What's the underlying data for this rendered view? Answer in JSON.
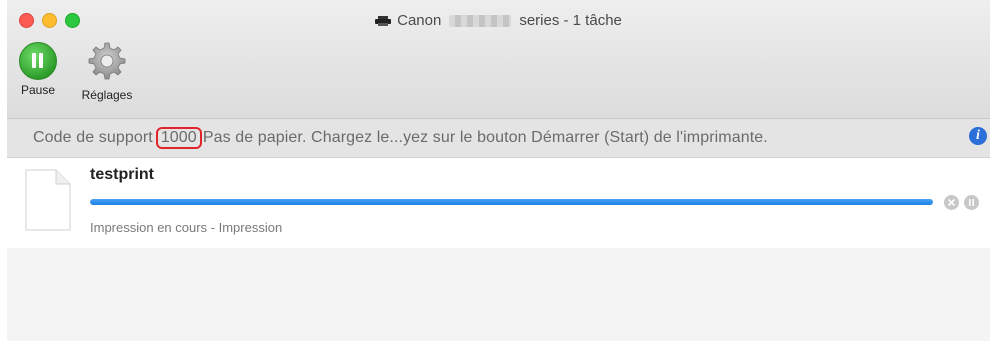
{
  "window": {
    "title_prefix": "Canon",
    "title_suffix": "series - 1 tâche",
    "printer_icon": "printer-icon"
  },
  "toolbar": {
    "pause_label": "Pause",
    "settings_label": "Réglages",
    "pause_icon": "pause-icon",
    "settings_icon": "gear-icon"
  },
  "status": {
    "prefix": "Code de support",
    "code": "1000",
    "message": "Pas de papier. Chargez le...yez sur le bouton Démarrer (Start) de l'imprimante.",
    "info_icon": "info-icon",
    "info_glyph": "i"
  },
  "job": {
    "name": "testprint",
    "status": "Impression en cours - Impression",
    "progress": 1.0,
    "cancel_icon": "cancel-icon",
    "hold_icon": "pause-icon"
  },
  "colors": {
    "progress": "#1b7fe6",
    "highlight": "#e0262b",
    "info": "#2b6fd9"
  }
}
